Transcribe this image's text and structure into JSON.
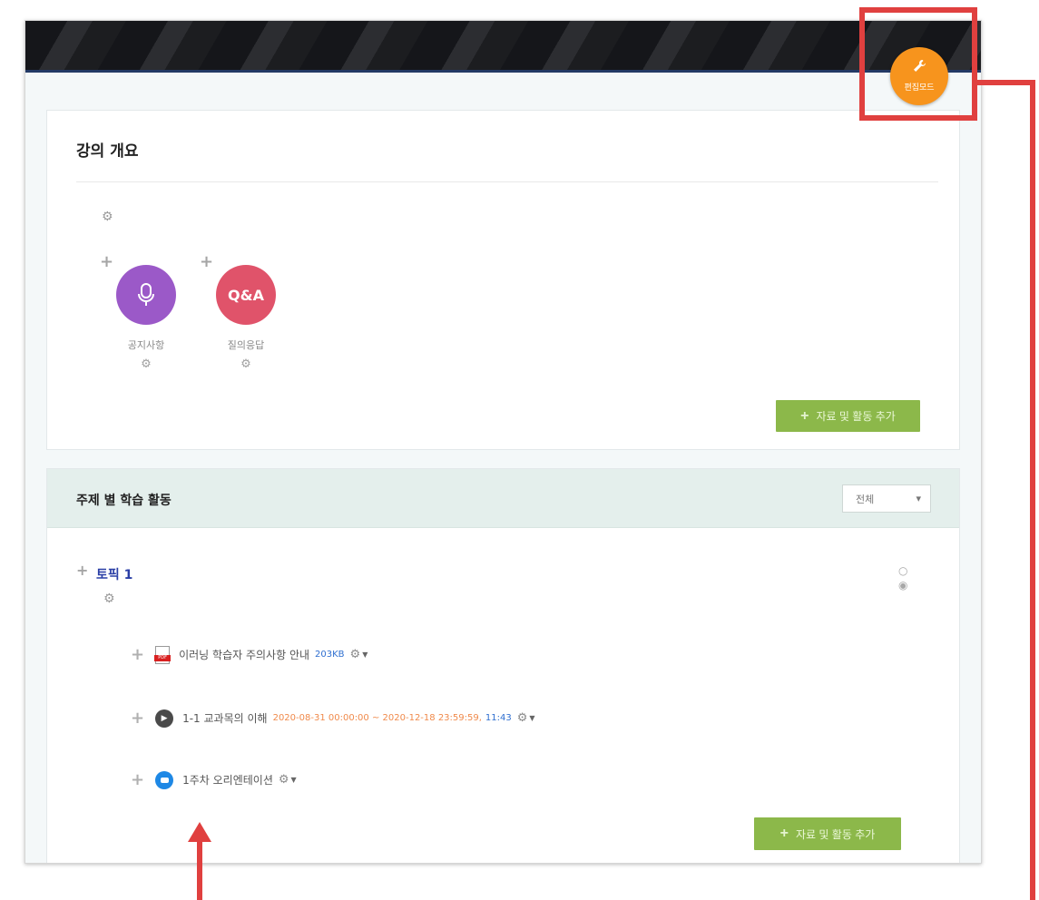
{
  "header": {
    "edit_mode_label": "편집모드",
    "edit_mode_icon": "wrench-icon",
    "accent_color": "#f7941d"
  },
  "overview": {
    "title": "강의 개요",
    "activities": [
      {
        "label": "공지사항",
        "icon": "microphone-icon",
        "color": "#9b59c8"
      },
      {
        "label": "질의응답",
        "icon_text": "Q&A",
        "color": "#e0536a"
      }
    ],
    "add_button_label": "자료 및 활동 추가"
  },
  "topics": {
    "title": "주제 별 학습 활동",
    "filter_value": "전체",
    "topic": {
      "title": "토픽 1",
      "items": [
        {
          "name": "이러닝 학습자 주의사항 안내",
          "meta": "203KB",
          "icon": "pdf-icon",
          "meta_color": "#2f6fd0"
        },
        {
          "name": "1-1 교과목의 이해",
          "meta": "2020-08-31 00:00:00 ~ 2020-12-18 23:59:59,",
          "meta_extra": "11:43",
          "icon": "play-icon",
          "meta_color": "#f08a4b"
        },
        {
          "name": "1주차 오리엔테이션",
          "meta": "",
          "icon": "zoom-icon"
        }
      ],
      "add_button_label": "자료 및 활동 추가"
    }
  },
  "colors": {
    "add_button": "#8cb84a",
    "annotation": "#e0403f",
    "topic_title": "#2a3ea6"
  }
}
